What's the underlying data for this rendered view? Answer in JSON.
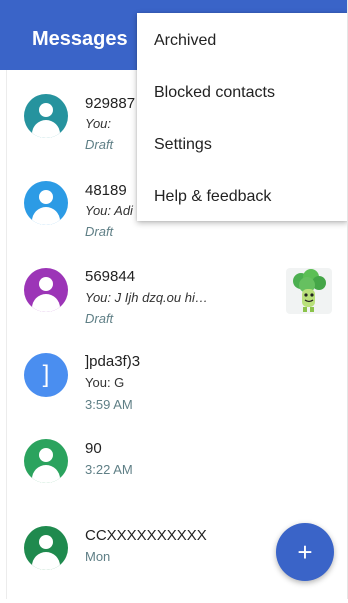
{
  "appbar": {
    "title": "Messages",
    "color": "#3a64c8"
  },
  "conversations": [
    {
      "name": "929887",
      "snippet": "You:",
      "meta": "Draft",
      "avatar_color": "#26939e",
      "avatar_icon": "person-icon"
    },
    {
      "name": "48189",
      "snippet": "You: Adi",
      "meta": "Draft",
      "avatar_color": "#2c9be5",
      "avatar_icon": "person-icon"
    },
    {
      "name": "569844",
      "snippet": "You: J Ijh dzq.ou hi…",
      "meta": "Draft",
      "avatar_color": "#9c35b7",
      "avatar_icon": "person-icon",
      "attachment": "broccoli-sticker"
    },
    {
      "name": "]pda3f)3",
      "snippet": "You: G",
      "meta": "3:59 AM",
      "avatar_color": "#4a8ef0",
      "avatar_letter": "]"
    },
    {
      "name": "90",
      "meta": "3:22 AM",
      "avatar_color": "#2ba35e",
      "avatar_icon": "person-icon"
    },
    {
      "name": "CCXXXXXXXXXX",
      "meta": "Mon",
      "avatar_color": "#1f8a4e",
      "avatar_icon": "person-icon"
    }
  ],
  "overflow_menu": {
    "items": [
      {
        "label": "Archived"
      },
      {
        "label": "Blocked contacts"
      },
      {
        "label": "Settings"
      },
      {
        "label": "Help & feedback"
      }
    ]
  },
  "fab": {
    "icon": "plus-icon",
    "symbol": "+"
  }
}
